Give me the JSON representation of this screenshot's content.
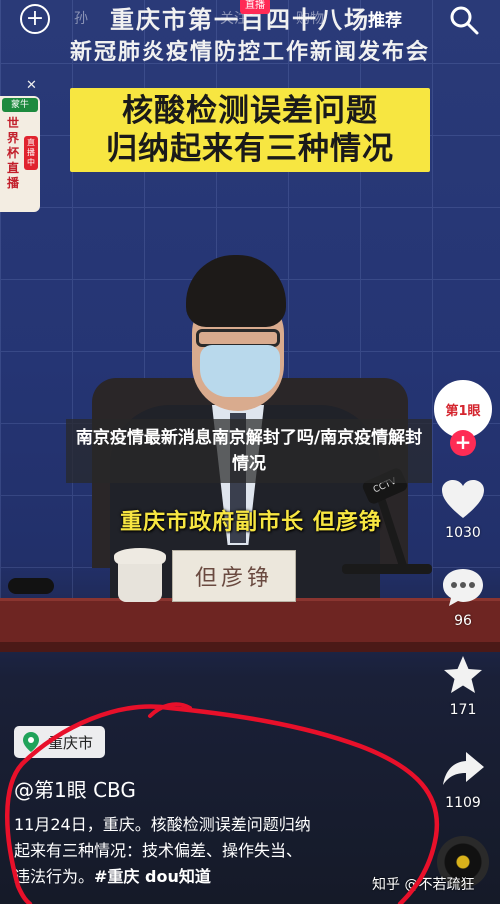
{
  "top_bar": {
    "nav_left_faint": "孙",
    "nav_mid_faint": "关注",
    "nav_mid_faint_2": "购物",
    "live_tag": "直播",
    "recommend": "推荐"
  },
  "video": {
    "conference_title_line1": "重庆市第一百四十八场",
    "conference_title_line2": "新冠肺炎疫情防控工作新闻发布会",
    "banner_line1": "核酸检测误差问题",
    "banner_line2": "归纳起来有三种情况",
    "speaker_caption": "重庆市政府副市长 但彦铮",
    "nameplate": "但彦铮",
    "mic_brand": "CCTV"
  },
  "world_cup_widget": {
    "brand": "蒙牛",
    "title": "世界杯直播",
    "live": "直播中"
  },
  "overlay_title": "南京疫情最新消息南京解封了吗/南京疫情解封情况",
  "right_rail": {
    "avatar_label": "第1眼",
    "likes": "1030",
    "comments": "96",
    "favorites": "171",
    "shares": "1109"
  },
  "bottom": {
    "location": "重庆市",
    "author": "@第1眼 CBG",
    "description_line1": "11月24日，重庆。核酸检测误差问题归纳",
    "description_line2": "起来有三种情况：技术偏差、操作失当、",
    "description_line3_prefix": "违法行为。",
    "hashtag": "#重庆 dou知道",
    "watermark": "知乎 @不若疏狂"
  },
  "colors": {
    "accent_red": "#fe2c55",
    "banner_yellow": "#f7e641",
    "annotation_red": "#e8102a"
  }
}
